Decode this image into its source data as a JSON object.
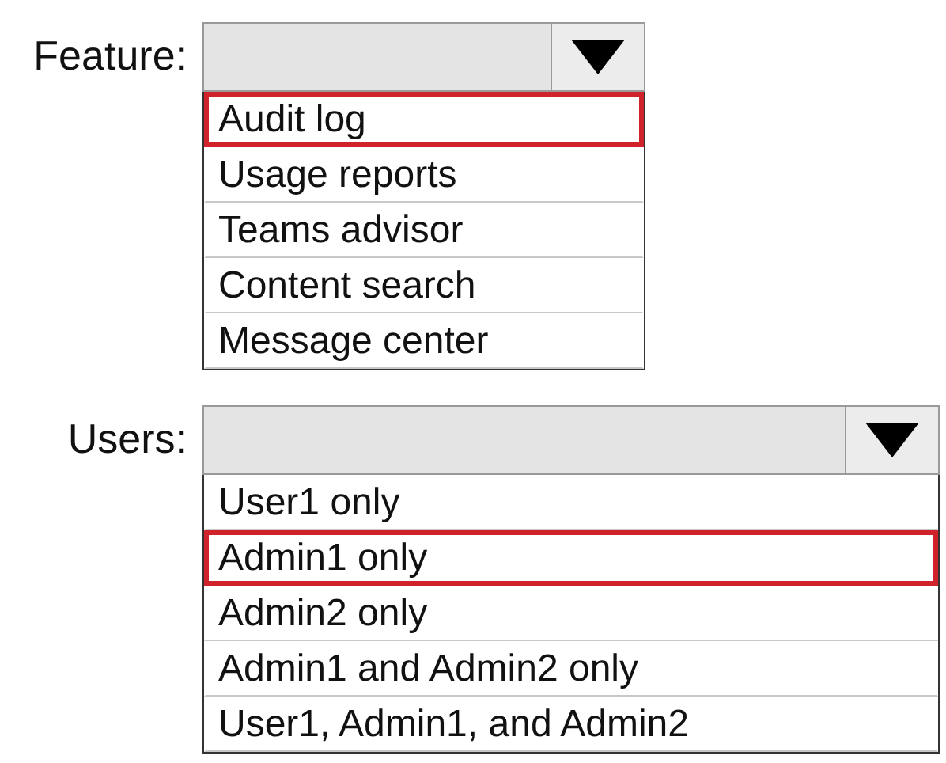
{
  "dropdowns": [
    {
      "label": "Feature:",
      "options": [
        {
          "label": "Audit log",
          "selected": true
        },
        {
          "label": "Usage reports",
          "selected": false
        },
        {
          "label": "Teams advisor",
          "selected": false
        },
        {
          "label": "Content search",
          "selected": false
        },
        {
          "label": "Message center",
          "selected": false
        }
      ]
    },
    {
      "label": "Users:",
      "options": [
        {
          "label": "User1 only",
          "selected": false
        },
        {
          "label": "Admin1 only",
          "selected": true
        },
        {
          "label": "Admin2 only",
          "selected": false
        },
        {
          "label": "Admin1 and Admin2 only",
          "selected": false
        },
        {
          "label": "User1, Admin1, and Admin2",
          "selected": false
        }
      ]
    }
  ]
}
